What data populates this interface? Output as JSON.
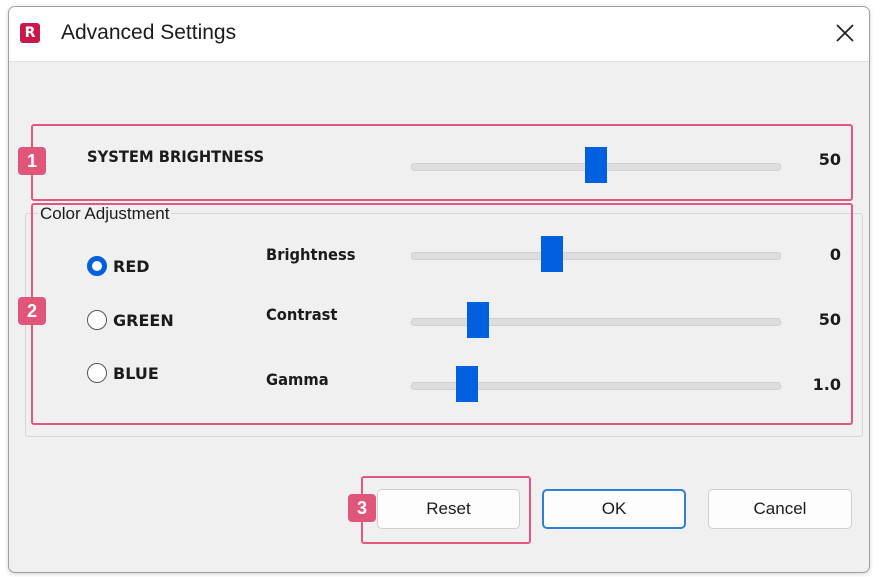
{
  "window": {
    "title": "Advanced Settings",
    "app_icon_letter": "R",
    "accent_color": "#0060df",
    "highlight_color": "#e4577e"
  },
  "annotations": [
    "1",
    "2",
    "3"
  ],
  "system": {
    "label": "SYSTEM BRIGHTNESS",
    "value_text": "50",
    "slider_fraction": 0.5
  },
  "color_adjustment": {
    "title": "Color Adjustment",
    "channels": [
      {
        "label": "RED",
        "selected": true
      },
      {
        "label": "GREEN",
        "selected": false
      },
      {
        "label": "BLUE",
        "selected": false
      }
    ],
    "sliders": [
      {
        "label": "Brightness",
        "value_text": "0",
        "fraction": 0.38
      },
      {
        "label": "Contrast",
        "value_text": "50",
        "fraction": 0.18
      },
      {
        "label": "Gamma",
        "value_text": "1.0",
        "fraction": 0.15
      }
    ]
  },
  "buttons": {
    "reset": "Reset",
    "ok": "OK",
    "cancel": "Cancel"
  },
  "icons": {
    "close": "close-icon",
    "app": "app-logo-icon"
  }
}
